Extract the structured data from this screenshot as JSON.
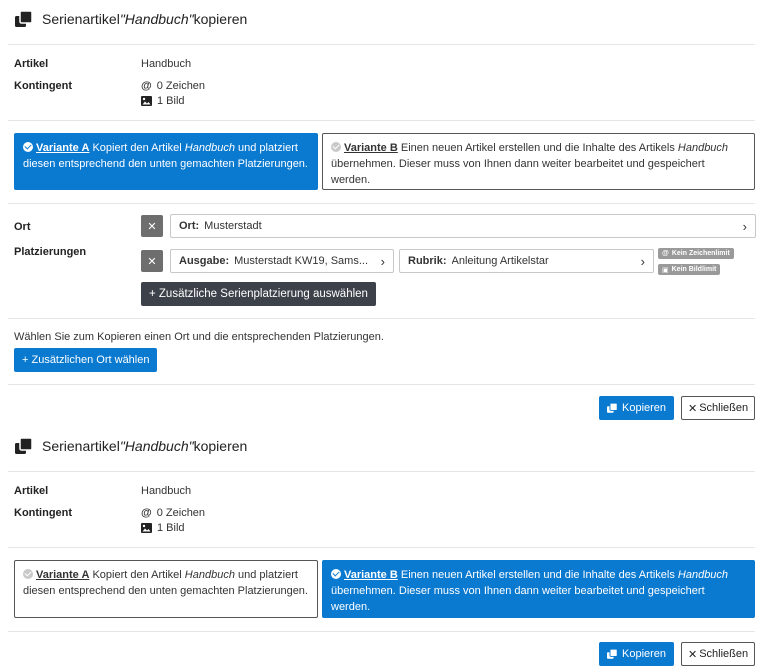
{
  "panel1": {
    "title_prefix": "Serienartikel ",
    "title_name": "\"Handbuch\"",
    "title_suffix": " kopieren",
    "artikel_label": "Artikel",
    "artikel_value": "Handbuch",
    "kontingent_label": "Kontingent",
    "zeichen": "0 Zeichen",
    "bild": "1 Bild",
    "variant_a": {
      "name": "Variante A",
      "text1": " Kopiert den Artikel ",
      "em": "Handbuch",
      "text2": " und platziert diesen entsprechend den unten gemachten Platzierungen."
    },
    "variant_b": {
      "name": "Variante B",
      "text1": " Einen neuen Artikel erstellen und die Inhalte des Artikels ",
      "em": "Handbuch",
      "text2": " übernehmen. Dieser muss von Ihnen dann weiter bearbeitet und gespeichert werden."
    },
    "ort_label": "Ort",
    "ort_select_key": "Ort:",
    "ort_select_value": "Musterstadt",
    "platzierungen_label": "Platzierungen",
    "ausgabe_key": "Ausgabe:",
    "ausgabe_value": "Musterstadt KW19, Sams...",
    "rubrik_key": "Rubrik:",
    "rubrik_value": "Anleitung Artikelstar",
    "badge_zeichen": "Kein Zeichenlimit",
    "badge_bild": "Kein Bildlimit",
    "add_placement_button": "+ Zusätzliche Serienplatzierung auswählen",
    "hint": "Wählen Sie zum Kopieren einen Ort und die entsprechenden Platzierungen.",
    "add_location_button": "+ Zusätzlichen Ort wählen",
    "copy_button": "Kopieren",
    "close_button": "Schließen",
    "active_variant": "A"
  },
  "panel2": {
    "title_prefix": "Serienartikel ",
    "title_name": "\"Handbuch\"",
    "title_suffix": " kopieren",
    "artikel_label": "Artikel",
    "artikel_value": "Handbuch",
    "kontingent_label": "Kontingent",
    "zeichen": "0 Zeichen",
    "bild": "1 Bild",
    "variant_a": {
      "name": "Variante A",
      "text1": " Kopiert den Artikel ",
      "em": "Handbuch",
      "text2": " und platziert diesen entsprechend den unten gemachten Platzierungen."
    },
    "variant_b": {
      "name": "Variante B",
      "text1": " Einen neuen Artikel erstellen und die Inhalte des Artikels ",
      "em": "Handbuch",
      "text2": " übernehmen. Dieser muss von Ihnen dann weiter bearbeitet und gespeichert werden."
    },
    "copy_button": "Kopieren",
    "close_button": "Schließen",
    "active_variant": "B"
  },
  "colors": {
    "accent": "#0a79d0",
    "dark_button": "#3d4149",
    "x_button": "#6e6e6e",
    "badge": "#9a9a9a"
  },
  "icons": [
    "copy-icon",
    "at-icon",
    "image-icon",
    "check-circle-icon",
    "close-icon",
    "chevron-right-icon"
  ]
}
